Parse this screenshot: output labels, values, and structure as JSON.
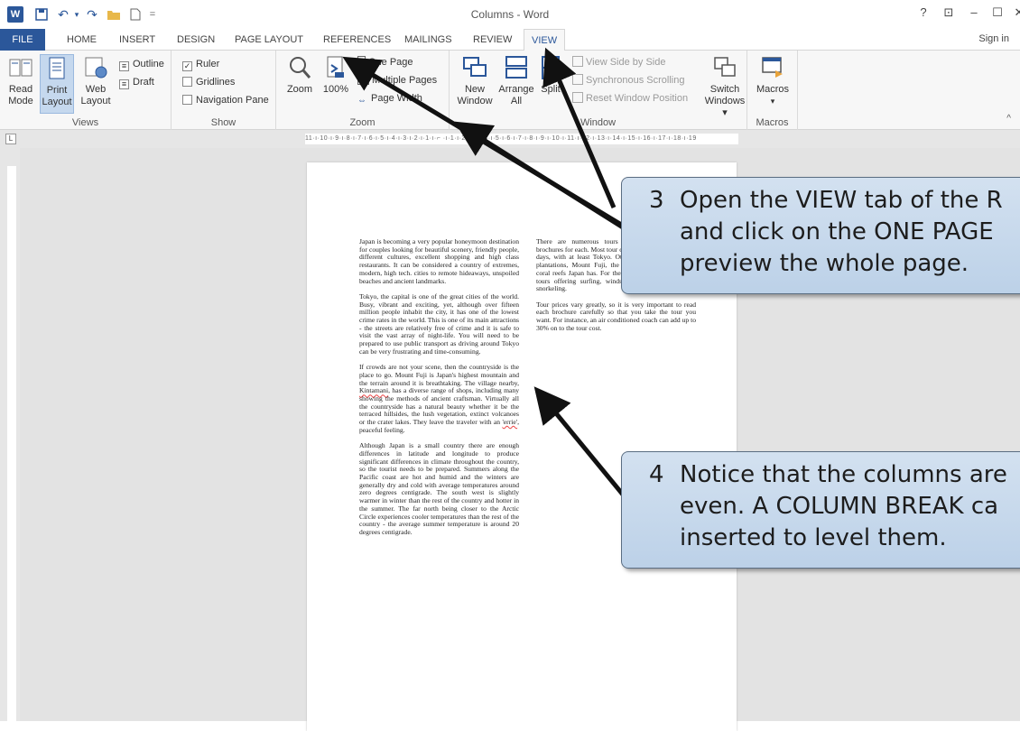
{
  "window": {
    "title": "Columns - Word",
    "help": "?",
    "restore_ribbon": "⊡",
    "minimize": "–",
    "maximize": "☐",
    "close": "✕"
  },
  "quick_access": {
    "app_icon": "W",
    "save": "💾",
    "undo": "↶",
    "redo": "↷",
    "open": "📂",
    "new": "🗋",
    "more": "="
  },
  "tabs": [
    "FILE",
    "HOME",
    "INSERT",
    "DESIGN",
    "PAGE LAYOUT",
    "REFERENCES",
    "MAILINGS",
    "REVIEW",
    "VIEW"
  ],
  "active_tab": "VIEW",
  "sign_in": "Sign in",
  "ribbon": {
    "views": {
      "label": "Views",
      "read_mode": [
        "Read",
        "Mode"
      ],
      "print_layout": [
        "Print",
        "Layout"
      ],
      "web_layout": [
        "Web",
        "Layout"
      ],
      "outline": "Outline",
      "draft": "Draft"
    },
    "show": {
      "label": "Show",
      "ruler": "Ruler",
      "gridlines": "Gridlines",
      "navigation_pane": "Navigation Pane",
      "ruler_checked": "✓"
    },
    "zoom": {
      "label": "Zoom",
      "zoom": "Zoom",
      "hundred": "100%",
      "one_page": "One Page",
      "multiple_pages": "Multiple Pages",
      "page_width": "Page Width"
    },
    "window": {
      "label": "Window",
      "new_window": [
        "New",
        "Window"
      ],
      "arrange_all": [
        "Arrange",
        "All"
      ],
      "split": "Split",
      "view_side_by_side": "View Side by Side",
      "synchronous_scrolling": "Synchronous Scrolling",
      "reset_window_position": "Reset Window Position",
      "switch_windows": [
        "Switch",
        "Windows ▾"
      ]
    },
    "macros": {
      "label": "Macros",
      "macros": "Macros",
      "arrow": "▾"
    }
  },
  "ruler": {
    "corner": "L",
    "text": "11·ı·10·ı·9·ı·8·ı·7·ı·6·ı·5·ı·4·ı·3·ı·2·ı·1·ı·⌐ ·ı·1·ı·2·ı·3·ı·4·ı·5·ı·6·ı·7·ı·8·ı·9·ı·10·ı·11·ı·12·ı·13·ı·14·ı·15·ı·16·ı·17·ı·18·ı·19"
  },
  "document": {
    "col1": [
      "Japan is becoming a very popular honeymoon destination for couples looking for beautiful scenery, friendly people, different cultures, excellent shopping and high class restaurants. It can be considered a country of extremes, modern, high tech. cities to remote hideaways, unspoiled beaches and ancient landmarks.",
      "Tokyo, the capital is one of the great cities of the world. Busy, vibrant and exciting, yet, although over fifteen million people inhabit the city, it has one of the lowest crime rates in the world. This is one of its main attractions - the streets are relatively free of crime and it is safe to visit the vast array of night-life. You will need to be prepared to use public transport as driving around Tokyo can be very frustrating and time-consuming."
    ],
    "col1_p3": {
      "before": "If crowds are not your scene, then the countryside is the place to go. Mount Fuji is Japan's highest mountain and the terrain around it is breathtaking. The village nearby, ",
      "name": "Kintamani",
      "after": ", has a diverse range of shops, including many showing the methods of ancient craftsman. Virtually all the countryside has a natural beauty whether it be the terraced hillsides, the lush vegetation, extinct volcanoes or the crater lakes. They leave the traveler with an ",
      "quoted": "'errie'",
      "end": ", peaceful feeling."
    },
    "col1_p4": "Although Japan is a small country there are enough differences in latitude and longitude to produce significant differences in climate throughout the country, so the tourist needs to be prepared. Summers along the Pacific coast are hot and humid and the winters are generally dry and cold with average temperatures around zero degrees centigrade. The south west is slightly warmer in winter than the rest of the country and hotter in the summer. The far north being closer to the Arctic Circle experiences cooler temperatures than the rest of the country - the average summer temperature is around 20 degrees centigrade.",
    "col2": [
      "There are numerous tours available and we have brochures for each. Most tour operators offer from 6 to 15 days, with at least Tokyo. Other highlights include tea plantations, Mount Fuji, the ocean and the numerous coral reefs Japan has. For the adventurous, there is also tours offering surfing, windsurfing, scuba diving and snorkeling.",
      "Tour prices vary greatly, so it is very important to read each brochure carefully so that you take the tour you want. For instance, an air conditioned coach can add up to 30% on to the tour cost."
    ]
  },
  "callouts": {
    "c3": {
      "num": "3",
      "line1": "Open the VIEW tab of the R",
      "line2": "and click on the ONE PAGE",
      "line3": "preview the whole page."
    },
    "c4": {
      "num": "4",
      "line1": "Notice that the columns are",
      "line2": "even.  A COLUMN BREAK ca",
      "line3": "inserted to level them."
    }
  },
  "colors": {
    "accent": "#2b579a",
    "callout_fill": "#c6d9ee",
    "arrow": "#111111"
  }
}
